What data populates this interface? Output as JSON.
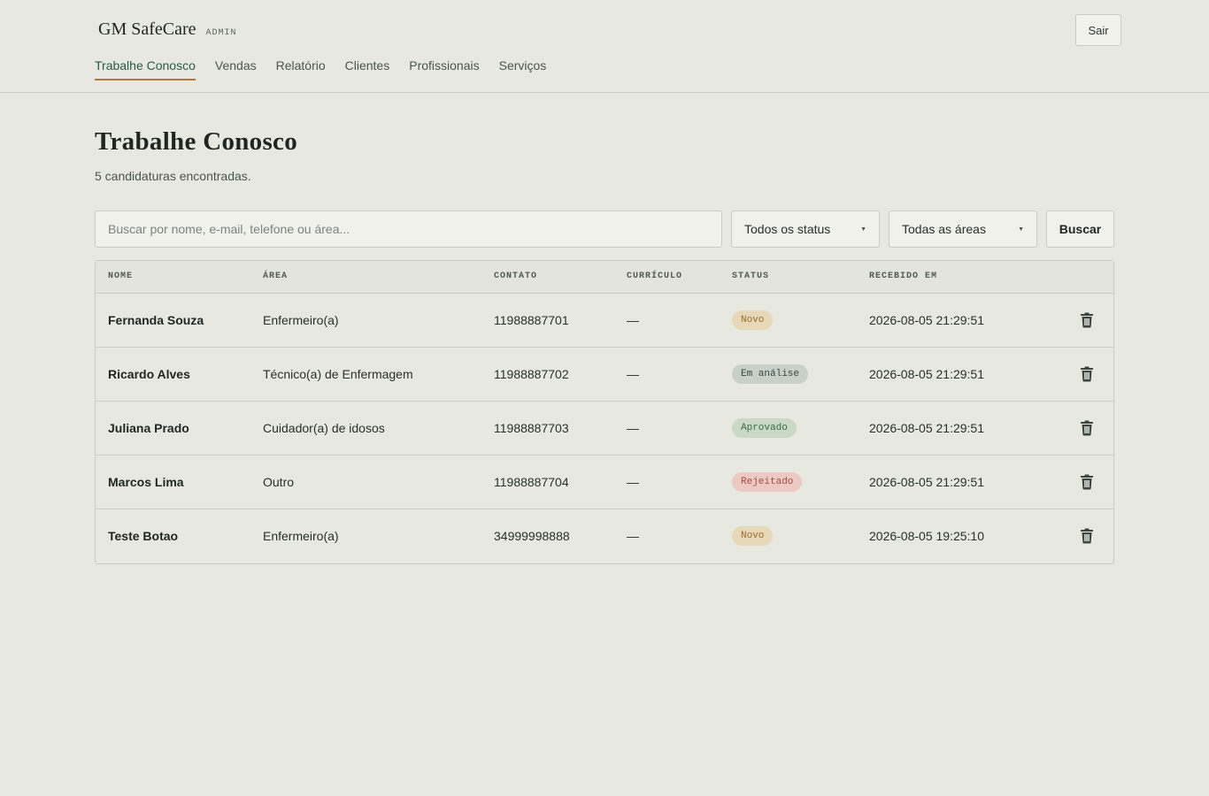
{
  "header": {
    "brand": "GM SafeCare",
    "brand_tag": "ADMIN",
    "logout_label": "Sair",
    "nav": [
      {
        "label": "Trabalhe Conosco",
        "active": true
      },
      {
        "label": "Vendas",
        "active": false
      },
      {
        "label": "Relatório",
        "active": false
      },
      {
        "label": "Clientes",
        "active": false
      },
      {
        "label": "Profissionais",
        "active": false
      },
      {
        "label": "Serviços",
        "active": false
      }
    ]
  },
  "main": {
    "title": "Trabalhe Conosco",
    "subtitle": "5 candidaturas encontradas."
  },
  "filters": {
    "search_placeholder": "Buscar por nome, e-mail, telefone ou área...",
    "search_value": "",
    "status_selected": "Todos os status",
    "area_selected": "Todas as áreas",
    "search_button": "Buscar"
  },
  "table": {
    "columns": [
      "Nome",
      "Área",
      "Contato",
      "Currículo",
      "Status",
      "Recebido em"
    ],
    "rows": [
      {
        "name": "Fernanda Souza",
        "area": "Enfermeiro(a)",
        "contact": "11988887701",
        "cv": "—",
        "status": "Novo",
        "received": "2026-08-05 21:29:51"
      },
      {
        "name": "Ricardo Alves",
        "area": "Técnico(a) de Enfermagem",
        "contact": "11988887702",
        "cv": "—",
        "status": "Em análise",
        "received": "2026-08-05 21:29:51"
      },
      {
        "name": "Juliana Prado",
        "area": "Cuidador(a) de idosos",
        "contact": "11988887703",
        "cv": "—",
        "status": "Aprovado",
        "received": "2026-08-05 21:29:51"
      },
      {
        "name": "Marcos Lima",
        "area": "Outro",
        "contact": "11988887704",
        "cv": "—",
        "status": "Rejeitado",
        "received": "2026-08-05 21:29:51"
      },
      {
        "name": "Teste Botao",
        "area": "Enfermeiro(a)",
        "contact": "34999998888",
        "cv": "—",
        "status": "Novo",
        "received": "2026-08-05 19:25:10"
      }
    ]
  },
  "status_colors": {
    "Novo": {
      "bg": "#e7d8b9",
      "fg": "#9a6f2b"
    },
    "Em análise": {
      "bg": "#c8d0c8",
      "fg": "#34463d"
    },
    "Aprovado": {
      "bg": "#c9d9c5",
      "fg": "#3f6a44"
    },
    "Rejeitado": {
      "bg": "#ecc9c2",
      "fg": "#a24d41"
    }
  },
  "icons": {
    "delete": "trash-icon",
    "dropdown": "caret-down-icon"
  },
  "colors": {
    "background": "#e7e9e1",
    "accent_underline": "#b07a3c",
    "active_nav": "#2b5b48"
  }
}
